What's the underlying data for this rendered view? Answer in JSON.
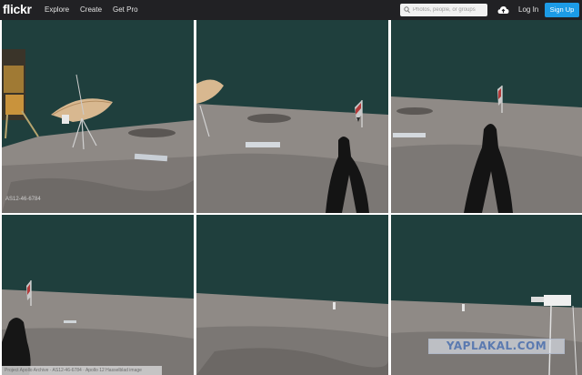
{
  "header": {
    "logo": "flickr",
    "nav": [
      "Explore",
      "Create",
      "Get Pro"
    ],
    "search_placeholder": "Photos, people, or groups",
    "login_label": "Log In",
    "signup_label": "Sign Up"
  },
  "colors": {
    "topbar": "#212124",
    "signup": "#1c9be6",
    "sky": "#1f3f3d",
    "regolith": "#8f8a88"
  },
  "photos": {
    "first_id": "AS12-46-6784",
    "attribution": "Project Apollo Archive · AS12-46-6784 · Apollo 12 Hasselblad image",
    "watermark": "YAPLAKAL.COM"
  },
  "icons": {
    "search": "search-icon",
    "upload": "upload-cloud-icon"
  }
}
